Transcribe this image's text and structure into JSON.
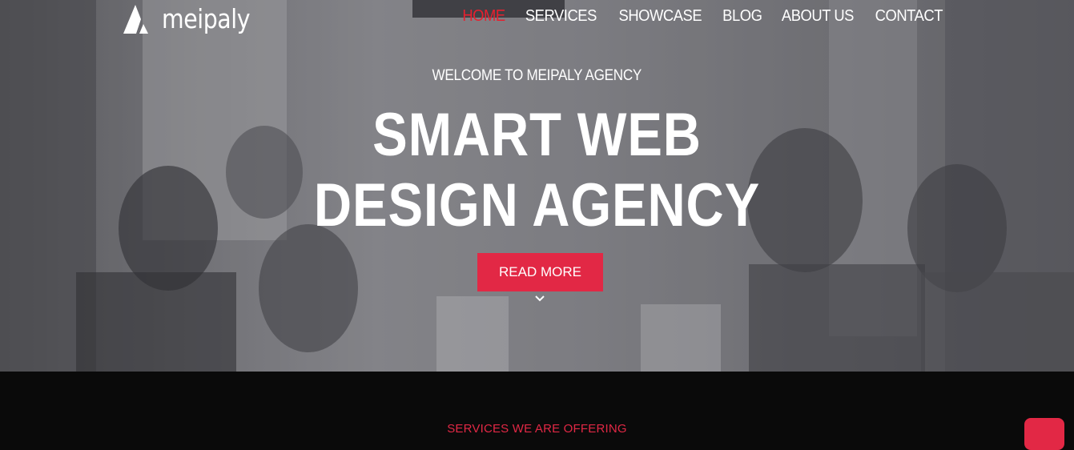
{
  "brand": {
    "name": "meipaly"
  },
  "nav": {
    "items": [
      {
        "label": "HOME",
        "active": true
      },
      {
        "label": "SERVICES"
      },
      {
        "label": "SHOWCASE"
      },
      {
        "label": "BLOG"
      },
      {
        "label": "ABOUT US"
      },
      {
        "label": "CONTACT"
      }
    ]
  },
  "hero": {
    "welcome": "WELCOME TO MEIPALY AGENCY",
    "headline_line1": "SMART WEB",
    "headline_line2": "DESIGN AGENCY",
    "cta_label": "READ MORE"
  },
  "services": {
    "label": "SERVICES WE ARE OFFERING"
  },
  "colors": {
    "accent": "#e22845",
    "nav_active": "#e6202f",
    "dark_section": "#0a0a0a"
  },
  "icons": {
    "logo": "logo-mark-icon",
    "scroll": "chevron-down-icon"
  }
}
